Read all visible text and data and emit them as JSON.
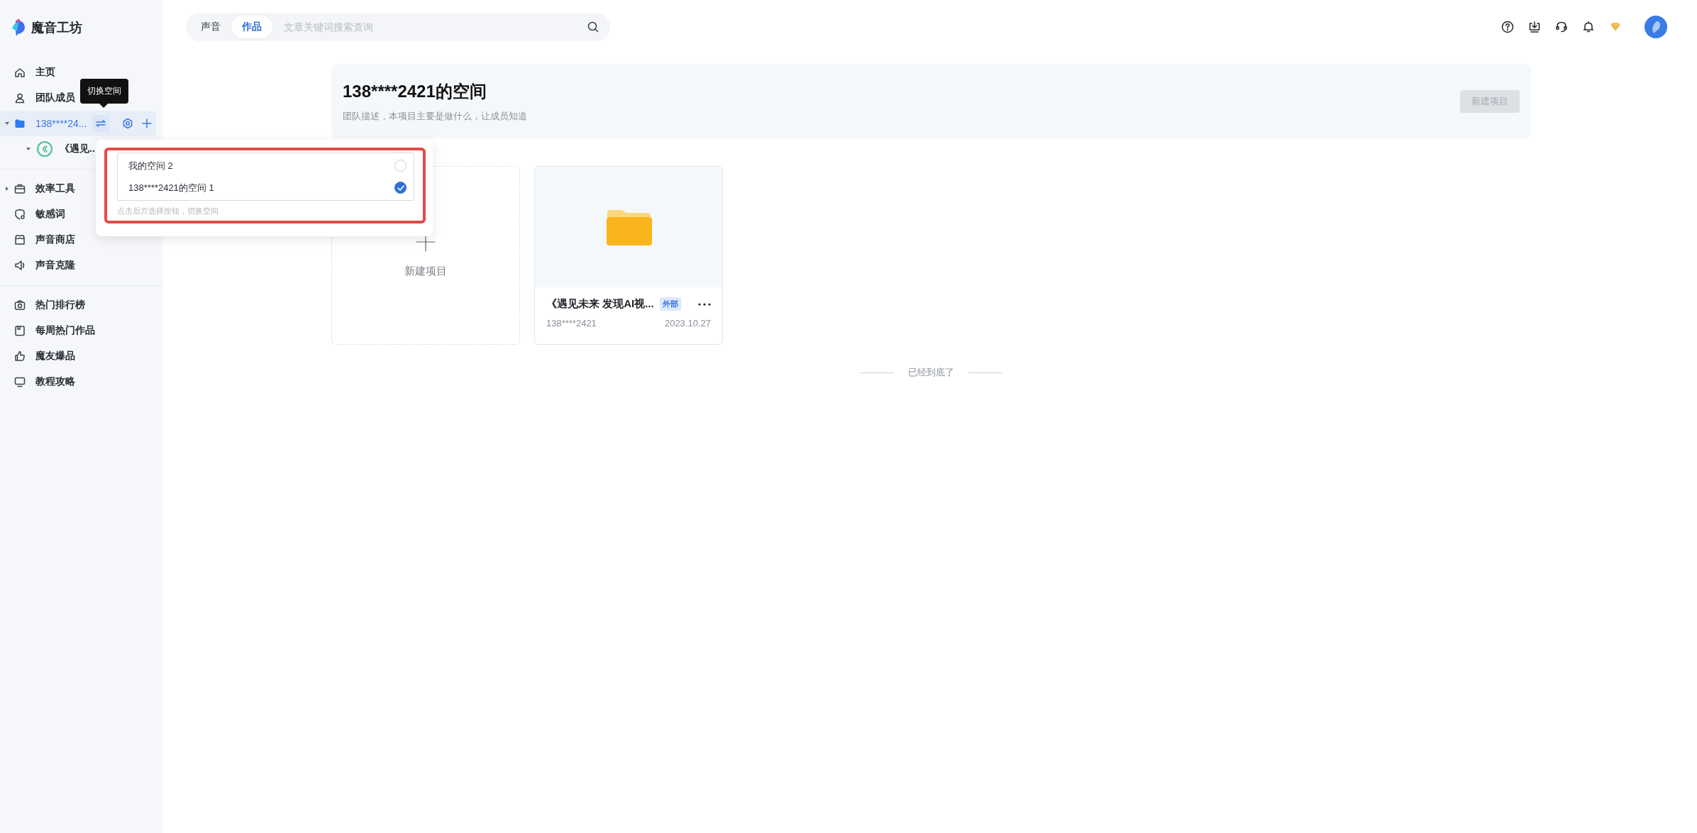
{
  "app": {
    "name": "魔音工坊"
  },
  "sidebar": {
    "groups": [
      [
        {
          "kind": "link",
          "label": "主页",
          "selected": false
        },
        {
          "kind": "link",
          "label": "团队成员",
          "selected": false
        },
        {
          "kind": "space",
          "label": "138****24...",
          "selected": true,
          "expanded": true,
          "children": [
            {
              "label": "《遇见..",
              "expanded": true
            }
          ]
        }
      ],
      [
        {
          "kind": "folder",
          "label": "效率工具",
          "selected": false,
          "expanded": false
        },
        {
          "kind": "link",
          "label": "敏感词",
          "selected": false
        },
        {
          "kind": "link",
          "label": "声音商店",
          "selected": false
        },
        {
          "kind": "link",
          "label": "声音克隆",
          "selected": false
        }
      ],
      [
        {
          "kind": "link",
          "label": "热门排行榜",
          "selected": false
        },
        {
          "kind": "link",
          "label": "每周热门作品",
          "selected": false
        },
        {
          "kind": "link",
          "label": "魔友爆品",
          "selected": false
        },
        {
          "kind": "link",
          "label": "教程攻略",
          "selected": false
        }
      ]
    ]
  },
  "tooltip": {
    "text": "切换空间"
  },
  "space_switcher": {
    "options": [
      {
        "label": "我的空间 2",
        "selected": false
      },
      {
        "label": "138****2421的空间 1",
        "selected": true
      }
    ],
    "hint": "点击后方选择按钮，切换空间"
  },
  "search": {
    "tabs": [
      {
        "label": "声音",
        "selected": false
      },
      {
        "label": "作品",
        "selected": true
      }
    ],
    "placeholder": "文章关键词搜索查询"
  },
  "header": {
    "title": "138****2421的空间",
    "description": "团队描述，本项目主要是做什么，让成员知道",
    "button": {
      "label": "新建项目",
      "disabled": true
    }
  },
  "new_project": {
    "label": "新建项目"
  },
  "projects": [
    {
      "title": "《遇见未来 发现AI视...",
      "tag": "外部",
      "owner": "138****2421",
      "date": "2023.10.27"
    }
  ],
  "footer": {
    "text": "已经到底了"
  }
}
